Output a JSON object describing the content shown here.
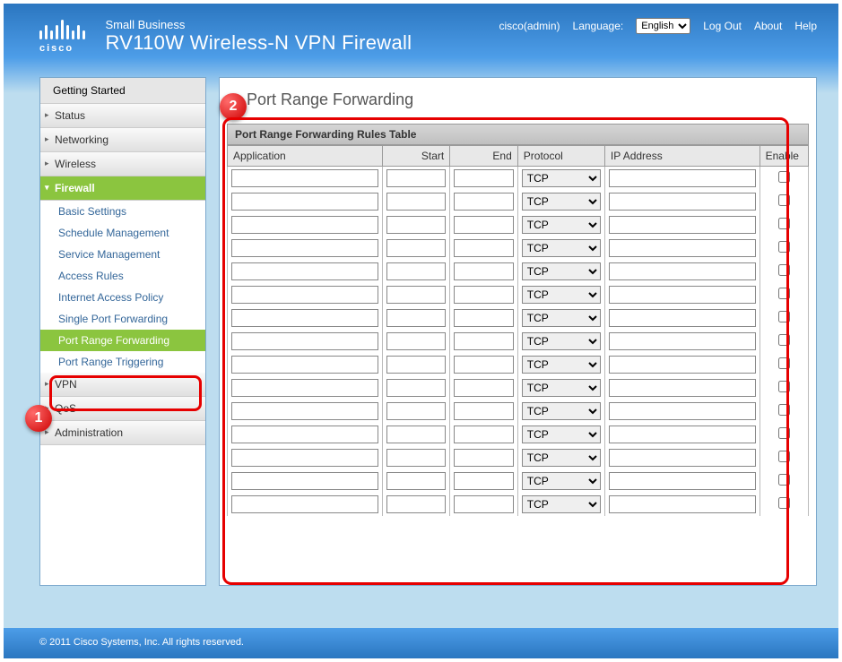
{
  "brand": {
    "logo_text": "cisco",
    "small_business": "Small Business",
    "model_title": "RV110W Wireless-N VPN Firewall"
  },
  "header": {
    "user_info": "cisco(admin)",
    "language_label": "Language:",
    "language_value": "English",
    "logout": "Log Out",
    "about": "About",
    "help": "Help"
  },
  "nav": {
    "top": "Getting Started",
    "sections": [
      {
        "label": "Status"
      },
      {
        "label": "Networking"
      },
      {
        "label": "Wireless"
      },
      {
        "label": "Firewall",
        "open": true,
        "items": [
          "Basic Settings",
          "Schedule Management",
          "Service Management",
          "Access Rules",
          "Internet Access Policy",
          "Single Port Forwarding",
          "Port Range Forwarding",
          "Port Range Triggering"
        ],
        "active_item": "Port Range Forwarding"
      },
      {
        "label": "VPN"
      },
      {
        "label": "QoS"
      },
      {
        "label": "Administration"
      }
    ]
  },
  "page": {
    "title": "Port Range Forwarding",
    "table_title": "Port Range Forwarding Rules Table",
    "columns": {
      "application": "Application",
      "start": "Start",
      "end": "End",
      "protocol": "Protocol",
      "ip_address": "IP Address",
      "enable": "Enable"
    },
    "protocol_option": "TCP",
    "row_count": 15
  },
  "annotations": {
    "marker1": "1",
    "marker2": "2"
  },
  "footer": {
    "copyright": "© 2011 Cisco Systems, Inc. All rights reserved."
  }
}
